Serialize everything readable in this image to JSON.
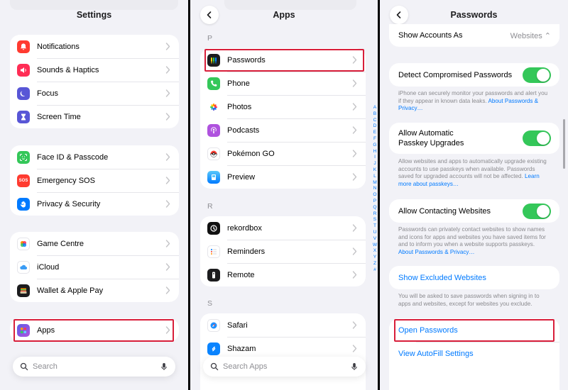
{
  "panel1": {
    "title": "Settings",
    "groups": [
      [
        {
          "label": "Notifications",
          "icon": "bell-icon",
          "color": "#ff3b30"
        },
        {
          "label": "Sounds & Haptics",
          "icon": "speaker-icon",
          "color": "#ff2d55"
        },
        {
          "label": "Focus",
          "icon": "moon-icon",
          "color": "#5856d6"
        },
        {
          "label": "Screen Time",
          "icon": "hourglass-icon",
          "color": "#5856d6"
        }
      ],
      [
        {
          "label": "Face ID & Passcode",
          "icon": "face-id-icon",
          "color": "#34c759"
        },
        {
          "label": "Emergency SOS",
          "icon": "sos-icon",
          "color": "#ff3b30",
          "text": "SOS"
        },
        {
          "label": "Privacy & Security",
          "icon": "hand-icon",
          "color": "#007aff"
        }
      ],
      [
        {
          "label": "Game Centre",
          "icon": "game-centre-icon",
          "color": "#ff9500"
        },
        {
          "label": "iCloud",
          "icon": "cloud-icon",
          "color": "#ffffff"
        },
        {
          "label": "Wallet & Apple Pay",
          "icon": "wallet-icon",
          "color": "#1c1c1e"
        }
      ],
      [
        {
          "label": "Apps",
          "icon": "apps-grid-icon",
          "color": "#5e5ce6"
        }
      ]
    ],
    "search_placeholder": "Search"
  },
  "panel2": {
    "title": "Apps",
    "sections": [
      {
        "letter": "P",
        "items": [
          {
            "label": "Passwords",
            "icon": "passwords-key-icon",
            "color": "#1c1c1e"
          },
          {
            "label": "Phone",
            "icon": "phone-icon",
            "color": "#34c759"
          },
          {
            "label": "Photos",
            "icon": "photos-flower-icon",
            "color": "#ffffff"
          },
          {
            "label": "Podcasts",
            "icon": "podcasts-icon",
            "color": "#af52de"
          },
          {
            "label": "Pokémon GO",
            "icon": "pokeball-icon",
            "color": "#ffffff"
          },
          {
            "label": "Preview",
            "icon": "preview-icon",
            "color": "#1e90ff"
          }
        ]
      },
      {
        "letter": "R",
        "items": [
          {
            "label": "rekordbox",
            "icon": "rekordbox-icon",
            "color": "#111111"
          },
          {
            "label": "Reminders",
            "icon": "reminders-icon",
            "color": "#ffffff"
          },
          {
            "label": "Remote",
            "icon": "remote-icon",
            "color": "#1c1c1e"
          }
        ]
      },
      {
        "letter": "S",
        "items": [
          {
            "label": "Safari",
            "icon": "safari-compass-icon",
            "color": "#ffffff"
          },
          {
            "label": "Shazam",
            "icon": "shazam-icon",
            "color": "#0a84ff"
          }
        ]
      }
    ],
    "alphabet": [
      "A",
      "B",
      "C",
      "D",
      "E",
      "F",
      "G",
      "H",
      "I",
      "J",
      "K",
      "L",
      "M",
      "N",
      "O",
      "P",
      "Q",
      "R",
      "S",
      "T",
      "U",
      "V",
      "W",
      "X",
      "Y",
      "Z",
      "#"
    ],
    "search_placeholder": "Search Apps"
  },
  "panel3": {
    "title": "Passwords",
    "show_accounts_label": "Show Accounts As",
    "show_accounts_value": "Websites",
    "detect_label": "Detect Compromised Passwords",
    "detect_note": "iPhone can securely monitor your passwords and alert you if they appear in known data leaks.",
    "detect_link": "About Passwords & Privacy…",
    "passkey_label_line1": "Allow Automatic",
    "passkey_label_line2": "Passkey Upgrades",
    "passkey_note": "Allow websites and apps to automatically upgrade existing accounts to use passkeys when available. Passwords saved for upgraded accounts will not be affected.",
    "passkey_link": "Learn more about passkeys…",
    "contact_label": "Allow Contacting Websites",
    "contact_note": "Passwords can privately contact websites to show names and icons for apps and websites you have saved items for and to inform you when a website supports passkeys.",
    "contact_link": "About Passwords & Privacy…",
    "excluded_label": "Show Excluded Websites",
    "excluded_note": "You will be asked to save passwords when signing in to apps and websites, except for websites you exclude.",
    "open_passwords_label": "Open Passwords",
    "autofill_label": "View AutoFill Settings"
  },
  "colors": {
    "accent": "#007aff",
    "toggle_on": "#34c759",
    "highlight": "#d81e3a"
  }
}
